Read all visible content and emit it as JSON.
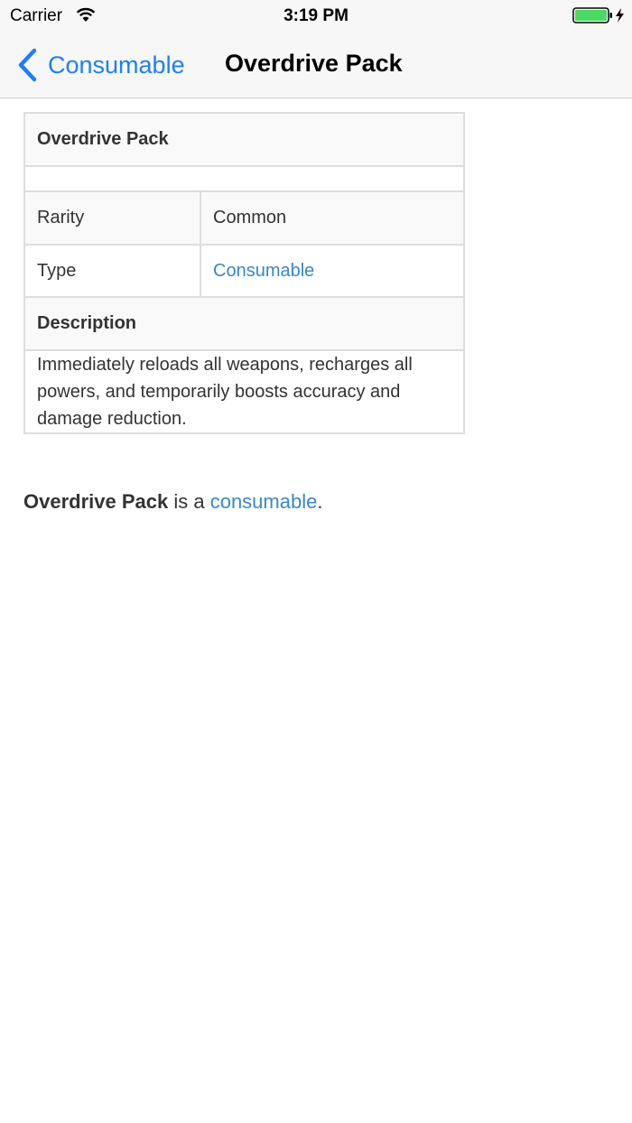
{
  "status_bar": {
    "carrier": "Carrier",
    "time": "3:19 PM",
    "wifi_icon": "wifi-icon",
    "battery_icon": "battery-charging-icon",
    "battery_color": "#4cd964"
  },
  "nav": {
    "back_label": "Consumable",
    "title": "Overdrive Pack",
    "accent": "#1f7ef6"
  },
  "infobox": {
    "title": "Overdrive Pack",
    "rows": [
      {
        "label": "Rarity",
        "value": "Common"
      },
      {
        "label": "Type",
        "value": "Consumable"
      }
    ],
    "description_heading": "Description",
    "description": "Immediately reloads all weapons, recharges all powers, and temporarily boosts accuracy and damage reduction."
  },
  "summary": {
    "bold": "Overdrive Pack",
    "middle": " is a ",
    "link": "consumable",
    "end": "."
  }
}
